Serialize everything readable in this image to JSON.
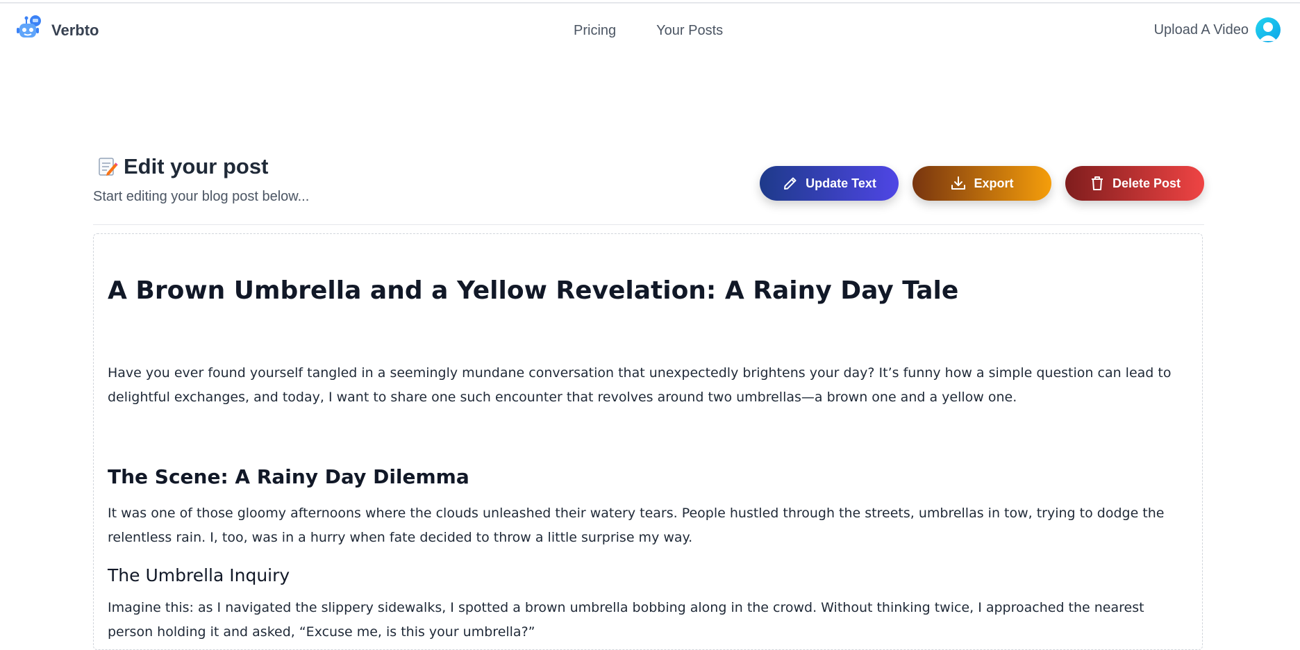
{
  "header": {
    "brand": "Verbto",
    "nav": [
      "Pricing",
      "Your Posts"
    ],
    "upload_label": "Upload A Video"
  },
  "editor": {
    "title": "Edit your post",
    "subtitle": "Start editing your blog post below...",
    "buttons": {
      "update": "Update Text",
      "export": "Export",
      "delete": "Delete Post"
    }
  },
  "post": {
    "title": "A Brown Umbrella and a Yellow Revelation: A Rainy Day Tale",
    "intro": "Have you ever found yourself tangled in a seemingly mundane conversation that unexpectedly brightens your day? It’s funny how a simple question can lead to delightful exchanges, and today, I want to share one such encounter that revolves around two umbrellas—a brown one and a yellow one.",
    "section1_title": "The Scene: A Rainy Day Dilemma",
    "section1_body": "It was one of those gloomy afternoons where the clouds unleashed their watery tears. People hustled through the streets, umbrellas in tow, trying to dodge the relentless rain. I, too, was in a hurry when fate decided to throw a little surprise my way.",
    "section2_title": "The Umbrella Inquiry",
    "section2_body": "Imagine this: as I navigated the slippery sidewalks, I spotted a brown umbrella bobbing along in the crowd. Without thinking twice, I approached the nearest person holding it and asked, “Excuse me, is this your umbrella?”"
  },
  "icons": {
    "logo": "robot-logo-icon",
    "avatar": "user-avatar-icon",
    "emoji": "memo-pencil-icon",
    "update": "pencil-icon",
    "export": "download-icon",
    "delete": "trash-icon"
  },
  "colors": {
    "update_gradient": [
      "#1e3a8a",
      "#4f46e5"
    ],
    "export_gradient": [
      "#78350f",
      "#f59e0b"
    ],
    "delete_gradient": [
      "#7f1d1d",
      "#ef4444"
    ],
    "avatar": "#22d3ee"
  }
}
